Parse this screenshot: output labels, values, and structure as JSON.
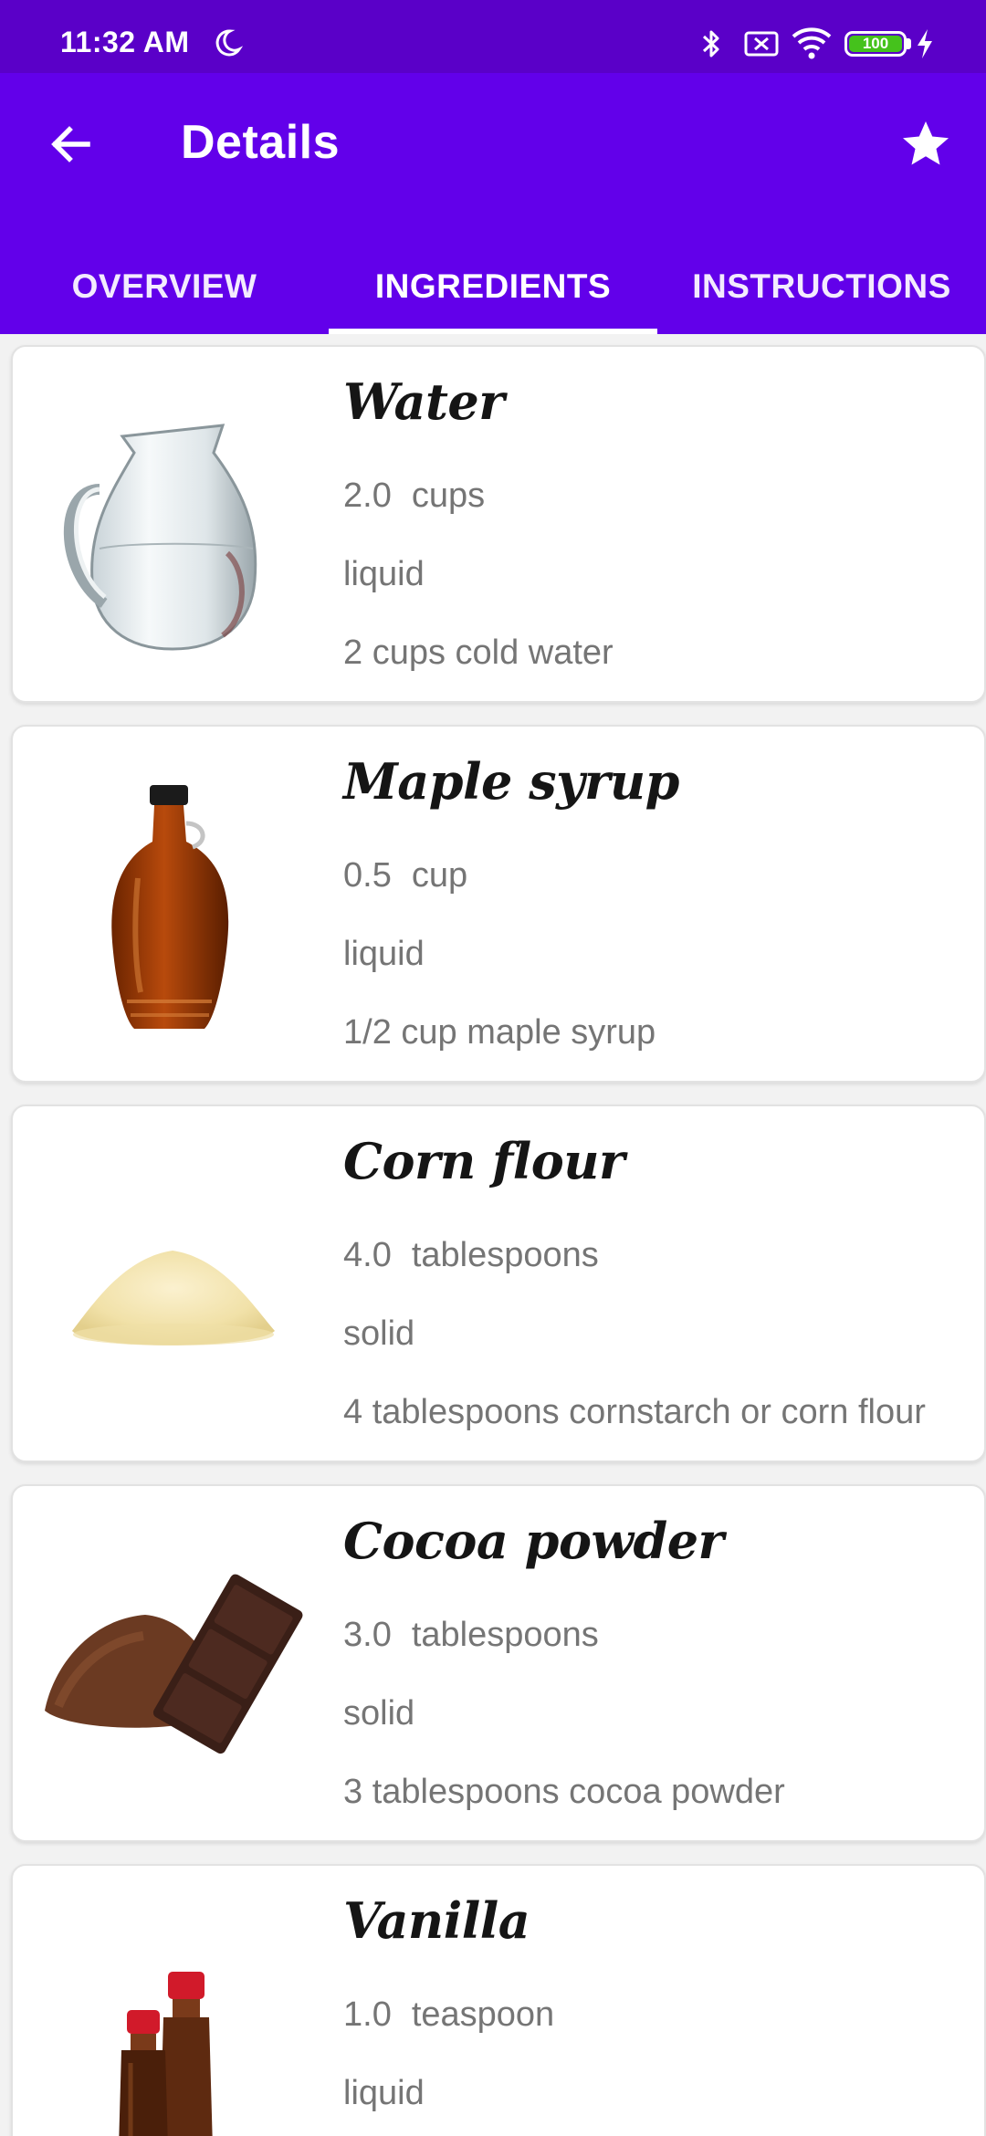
{
  "status_bar": {
    "time": "11:32 AM",
    "battery": "100",
    "icons": [
      "moon-icon",
      "bluetooth-icon",
      "no-sim-icon",
      "wifi-icon",
      "battery-icon",
      "charging-bolt-icon"
    ]
  },
  "app_bar": {
    "title": "Details",
    "back_icon": "arrow-left-icon",
    "favorite_icon": "star-icon",
    "background": "#6200ea",
    "status_background": "#5a00c8"
  },
  "tabs": [
    {
      "label": "OVERVIEW",
      "selected": false
    },
    {
      "label": "INGREDIENTS",
      "selected": true
    },
    {
      "label": "INSTRUCTIONS",
      "selected": false
    }
  ],
  "ingredients": [
    {
      "name": "Water",
      "amount": "2.0",
      "unit": "cups",
      "state": "liquid",
      "original": "2 cups cold water",
      "image": "water-jug-image"
    },
    {
      "name": "Maple syrup",
      "amount": "0.5",
      "unit": "cup",
      "state": "liquid",
      "original": "1/2 cup maple syrup",
      "image": "maple-syrup-bottle-image"
    },
    {
      "name": "Corn flour",
      "amount": "4.0",
      "unit": "tablespoons",
      "state": "solid",
      "original": "4 tablespoons cornstarch or corn flour",
      "image": "corn-flour-pile-image"
    },
    {
      "name": "Cocoa powder",
      "amount": "3.0",
      "unit": "tablespoons",
      "state": "solid",
      "original": "3 tablespoons cocoa powder",
      "image": "cocoa-powder-chocolate-image"
    },
    {
      "name": "Vanilla",
      "amount": "1.0",
      "unit": "teaspoon",
      "state": "liquid",
      "original": "",
      "image": "vanilla-bottles-image"
    }
  ]
}
